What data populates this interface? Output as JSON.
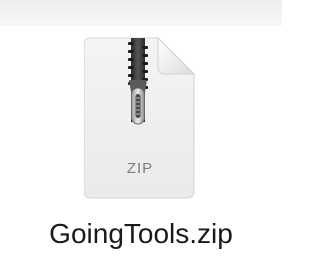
{
  "file": {
    "name": "GoingTools.zip",
    "extension_label": "ZIP",
    "icon": "zip-archive-icon"
  }
}
